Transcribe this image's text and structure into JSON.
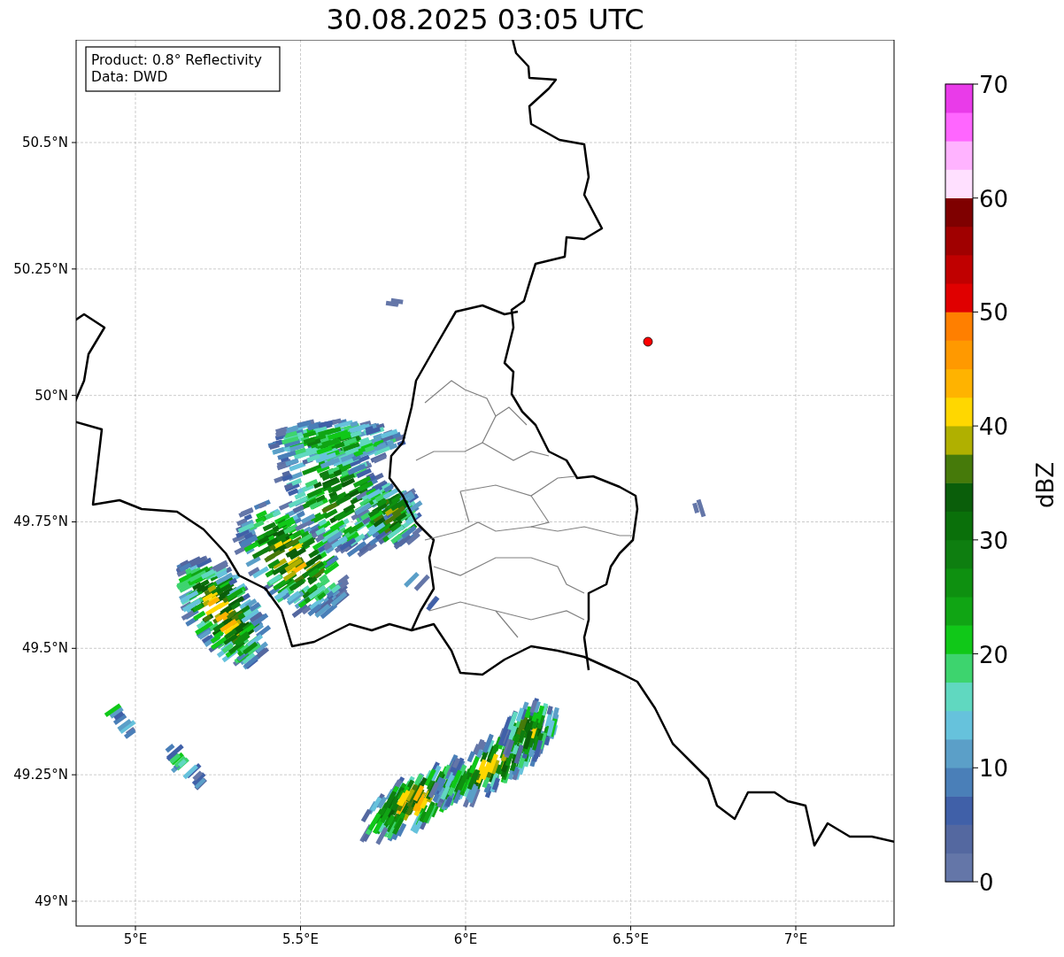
{
  "title": "30.08.2025 03:05 UTC",
  "info_box": {
    "lines": [
      "Product: 0.8° Reflectivity",
      "Data: DWD"
    ]
  },
  "map": {
    "x_ticks": [
      "5°E",
      "5.5°E",
      "6°E",
      "6.5°E",
      "7°E"
    ],
    "y_ticks": [
      "50.5°N",
      "50.25°N",
      "50°N",
      "49.75°N",
      "49.5°N",
      "49.25°N",
      "49°N"
    ]
  },
  "colorbar": {
    "label": "dBZ",
    "ticks": [
      "70",
      "60",
      "50",
      "40",
      "30",
      "20",
      "10",
      "0"
    ],
    "bands": [
      {
        "color": "#6476a8"
      },
      {
        "color": "#5468a0"
      },
      {
        "color": "#4060a8"
      },
      {
        "color": "#4a7fb8"
      },
      {
        "color": "#5b9fc8"
      },
      {
        "color": "#66c2dc"
      },
      {
        "color": "#60d8c0"
      },
      {
        "color": "#3dd46e"
      },
      {
        "color": "#10c818"
      },
      {
        "color": "#10a514"
      },
      {
        "color": "#0e9010"
      },
      {
        "color": "#0e7e10"
      },
      {
        "color": "#0a700a"
      },
      {
        "color": "#0a5e0a"
      },
      {
        "color": "#467a0a"
      },
      {
        "color": "#b0b000"
      },
      {
        "color": "#ffd700"
      },
      {
        "color": "#ffb300"
      },
      {
        "color": "#ff9900"
      },
      {
        "color": "#ff7f00"
      },
      {
        "color": "#e00000"
      },
      {
        "color": "#c00000"
      },
      {
        "color": "#a00000"
      },
      {
        "color": "#7f0000"
      },
      {
        "color": "#ffe0ff"
      },
      {
        "color": "#ffb3ff"
      },
      {
        "color": "#ff66ff"
      },
      {
        "color": "#e93be9"
      }
    ]
  }
}
